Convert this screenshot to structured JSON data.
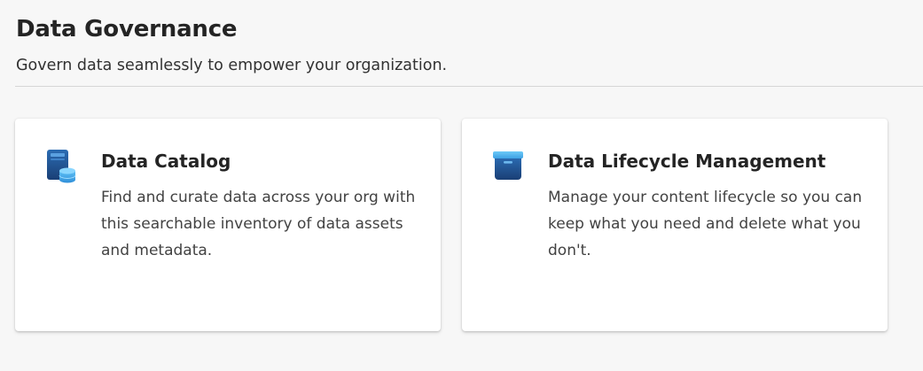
{
  "header": {
    "title": "Data Governance",
    "subtitle": "Govern data seamlessly to empower your organization."
  },
  "cards": [
    {
      "icon": "data-catalog-icon",
      "title": "Data Catalog",
      "description": "Find and curate data across your org with this searchable inventory of data assets and metadata."
    },
    {
      "icon": "data-lifecycle-icon",
      "title": "Data Lifecycle Management",
      "description": "Manage your content lifecycle so you can keep what you need and delete what you don't."
    }
  ],
  "colors": {
    "background": "#f7f7f7",
    "card": "#ffffff",
    "icon_dark_blue": "#1f4e8c",
    "icon_light_blue": "#4aa8e8"
  }
}
